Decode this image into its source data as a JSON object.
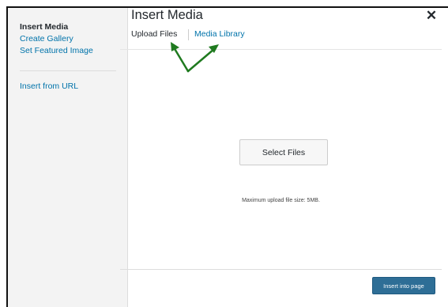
{
  "sidebar": {
    "items": [
      {
        "label": "Insert Media"
      },
      {
        "label": "Create Gallery"
      },
      {
        "label": "Set Featured Image"
      },
      {
        "label": "Insert from URL"
      }
    ]
  },
  "header": {
    "title": "Insert Media",
    "close_label": "✕"
  },
  "tabs": [
    {
      "label": "Upload Files"
    },
    {
      "label": "Media Library"
    }
  ],
  "uploader": {
    "select_label": "Select Files",
    "max_size_text": "Maximum upload file size: 5MB."
  },
  "footer": {
    "insert_label": "Insert into page"
  },
  "colors": {
    "link": "#0073aa",
    "primary_button": "#2e6e96",
    "annotation_arrow": "#1f7a1f"
  }
}
